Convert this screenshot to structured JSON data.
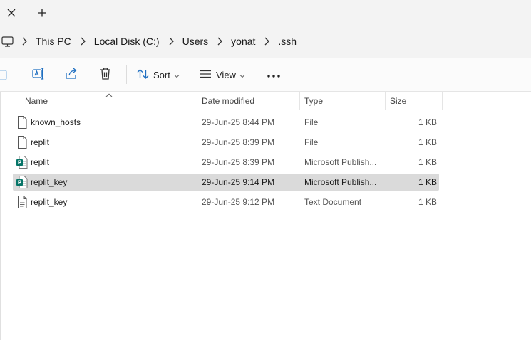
{
  "tabstrip": {
    "close_icon": "close-icon",
    "new_tab_icon": "plus-icon"
  },
  "breadcrumb": {
    "root_icon": "monitor-icon",
    "items": [
      "This PC",
      "Local Disk (C:)",
      "Users",
      "yonat",
      ".ssh"
    ]
  },
  "toolbar": {
    "sort_label": "Sort",
    "view_label": "View",
    "more_icon": "ellipsis-icon"
  },
  "columns": {
    "name": "Name",
    "date": "Date modified",
    "type": "Type",
    "size": "Size"
  },
  "files": [
    {
      "name": "known_hosts",
      "date": "29-Jun-25 8:44 PM",
      "type": "File",
      "size": "1 KB",
      "icon": "blank-file-icon",
      "selected": false
    },
    {
      "name": "replit",
      "date": "29-Jun-25 8:39 PM",
      "type": "File",
      "size": "1 KB",
      "icon": "blank-file-icon",
      "selected": false
    },
    {
      "name": "replit",
      "date": "29-Jun-25 8:39 PM",
      "type": "Microsoft Publish...",
      "size": "1 KB",
      "icon": "publisher-file-icon",
      "selected": false
    },
    {
      "name": "replit_key",
      "date": "29-Jun-25 9:14 PM",
      "type": "Microsoft Publish...",
      "size": "1 KB",
      "icon": "publisher-file-icon",
      "selected": true
    },
    {
      "name": "replit_key",
      "date": "29-Jun-25 9:12 PM",
      "type": "Text Document",
      "size": "1 KB",
      "icon": "text-file-icon",
      "selected": false
    }
  ],
  "colors": {
    "selected_row": "#dadada",
    "accent": "#0f6cbd",
    "publisher_green": "#077568"
  }
}
